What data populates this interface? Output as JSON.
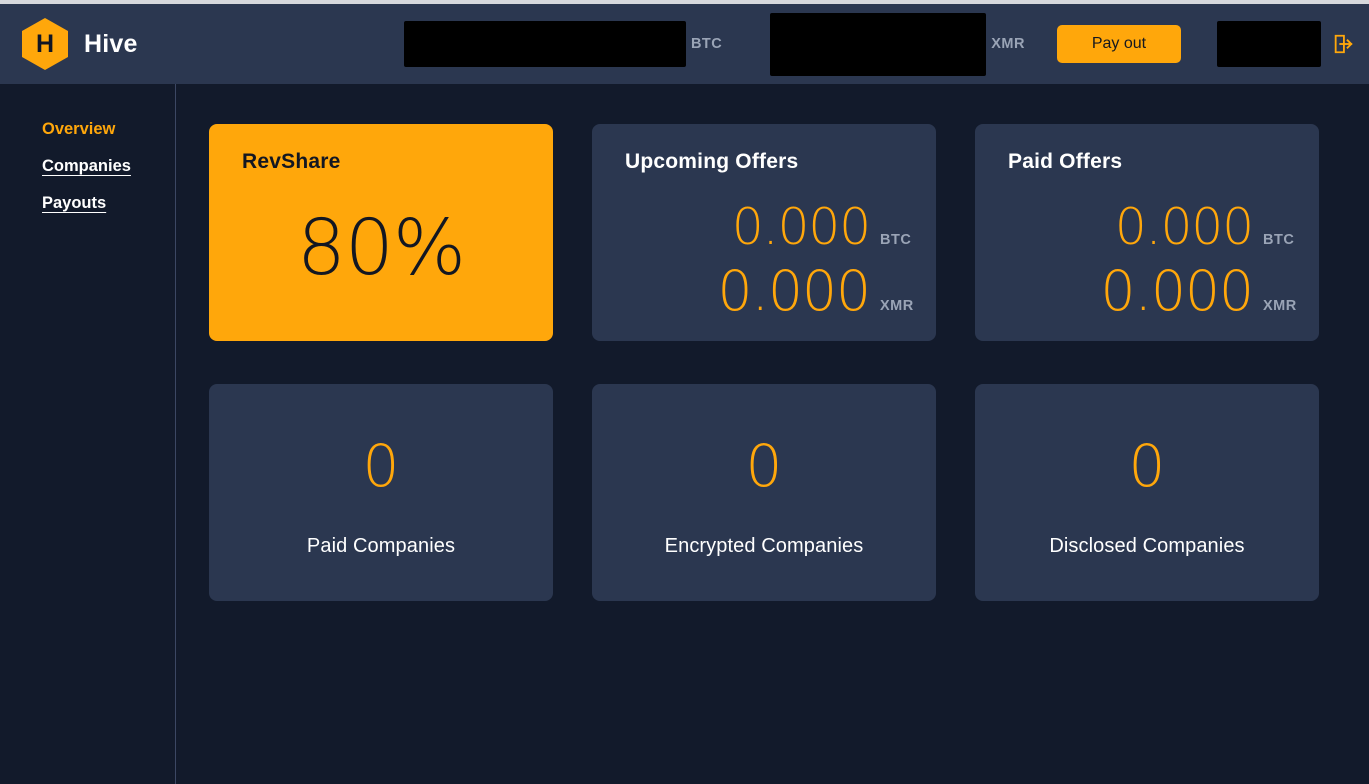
{
  "brand": {
    "logo_letter": "H",
    "name": "Hive",
    "logo_color": "#ffa70b"
  },
  "header": {
    "btc_input": {
      "value": "",
      "placeholder": "",
      "unit": "BTC",
      "redacted": true
    },
    "xmr_input": {
      "value": "",
      "placeholder": "",
      "unit": "XMR",
      "redacted": true
    },
    "payout_button": "Pay out",
    "account_box": {
      "value": "",
      "redacted": true
    },
    "logout_icon": "logout-icon"
  },
  "sidebar": {
    "items": [
      {
        "label": "Overview",
        "active": true
      },
      {
        "label": "Companies",
        "active": false
      },
      {
        "label": "Payouts",
        "active": false
      }
    ]
  },
  "main": {
    "revshare": {
      "title": "RevShare",
      "value": "80%"
    },
    "upcoming_offers": {
      "title": "Upcoming Offers",
      "btc_value": "0.000",
      "btc_unit": "BTC",
      "xmr_value": "0.000",
      "xmr_unit": "XMR"
    },
    "paid_offers": {
      "title": "Paid Offers",
      "btc_value": "0.000",
      "btc_unit": "BTC",
      "xmr_value": "0.000",
      "xmr_unit": "XMR"
    },
    "stats": [
      {
        "value": "0",
        "label": "Paid Companies"
      },
      {
        "value": "0",
        "label": "Encrypted Companies"
      },
      {
        "value": "0",
        "label": "Disclosed Companies"
      }
    ]
  },
  "colors": {
    "accent": "#ffa70b",
    "card_bg": "#2b3750",
    "page_bg": "#121a2b",
    "muted_text": "#9aa4b6"
  }
}
